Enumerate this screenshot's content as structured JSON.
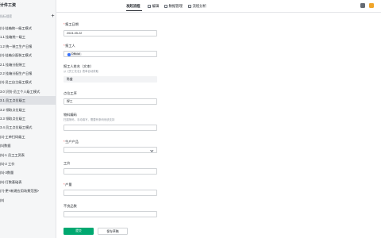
{
  "app": {
    "title": "计件工资"
  },
  "sidebar": {
    "search_placeholder": "指标搜索",
    "add_label": "+",
    "items": [
      {
        "label": "(1)-挂箱统一级工模式"
      },
      {
        "label": "1.1 挂箱统一级工"
      },
      {
        "label": "1.2 统一装工生产日报"
      },
      {
        "label": "(2)-挂箱分配装工模式"
      },
      {
        "label": "2.1 挂箱分配装工"
      },
      {
        "label": "2.2 挂箱分配生产日报"
      },
      {
        "label": "(3)-员工自主级工模式"
      },
      {
        "label": "3.0 识别-员工个人级工模式"
      },
      {
        "label": "3.1 员工点位级工",
        "active": true
      },
      {
        "label": "3.2 领取点位级工"
      },
      {
        "label": "3.3 领取点位级工"
      },
      {
        "label": "3.4 员工点位级工模式"
      },
      {
        "label": "(4)-工单扫码级工"
      },
      {
        "label": "(5)数据"
      },
      {
        "label": "(5)-1 员工工资表"
      },
      {
        "label": "(5)-2 工价"
      },
      {
        "label": "(5)-3数量"
      },
      {
        "label": "(6)-打数基础表"
      },
      {
        "label": "(7)-更<新建应用场景范围>"
      },
      {
        "label": "(8)"
      }
    ]
  },
  "topbar": {
    "items": [
      {
        "label": "发起流程",
        "icon": "none",
        "active": true
      },
      {
        "label": "编辑",
        "icon": "pencil-icon"
      },
      {
        "label": "数据管理",
        "icon": "table-icon"
      },
      {
        "label": "流程分析",
        "icon": "chart-icon"
      }
    ]
  },
  "form": {
    "fields": {
      "report_date": {
        "label": "报工日期",
        "required": true,
        "value": "2024-05-22"
      },
      "reporter": {
        "label": "报工人",
        "required": true,
        "value": "Official"
      },
      "reporter_name": {
        "label": "报工人姓名（文本）",
        "description": "从【员工花名】表单自动获取",
        "value": "陈盛"
      },
      "process": {
        "label": "点位工序",
        "value": "焊工"
      },
      "material_code": {
        "label": "物料编码",
        "description": "扫描条码，手动填写，需要有条码系统支持",
        "value": ""
      },
      "product": {
        "label": "生产产品",
        "required": true,
        "value": ""
      },
      "workstation": {
        "label": "工价",
        "value": ""
      },
      "output": {
        "label": "产量",
        "required": true,
        "value": ""
      },
      "defect": {
        "label": "不良品数",
        "value": ""
      }
    },
    "buttons": {
      "submit": "提交",
      "save_draft": "保存草稿"
    }
  },
  "colors": {
    "primary": "#00a870",
    "sidebar_bg": "#f5f6f7",
    "active_item_bg": "#dfe1e5",
    "required": "#f54a45"
  }
}
